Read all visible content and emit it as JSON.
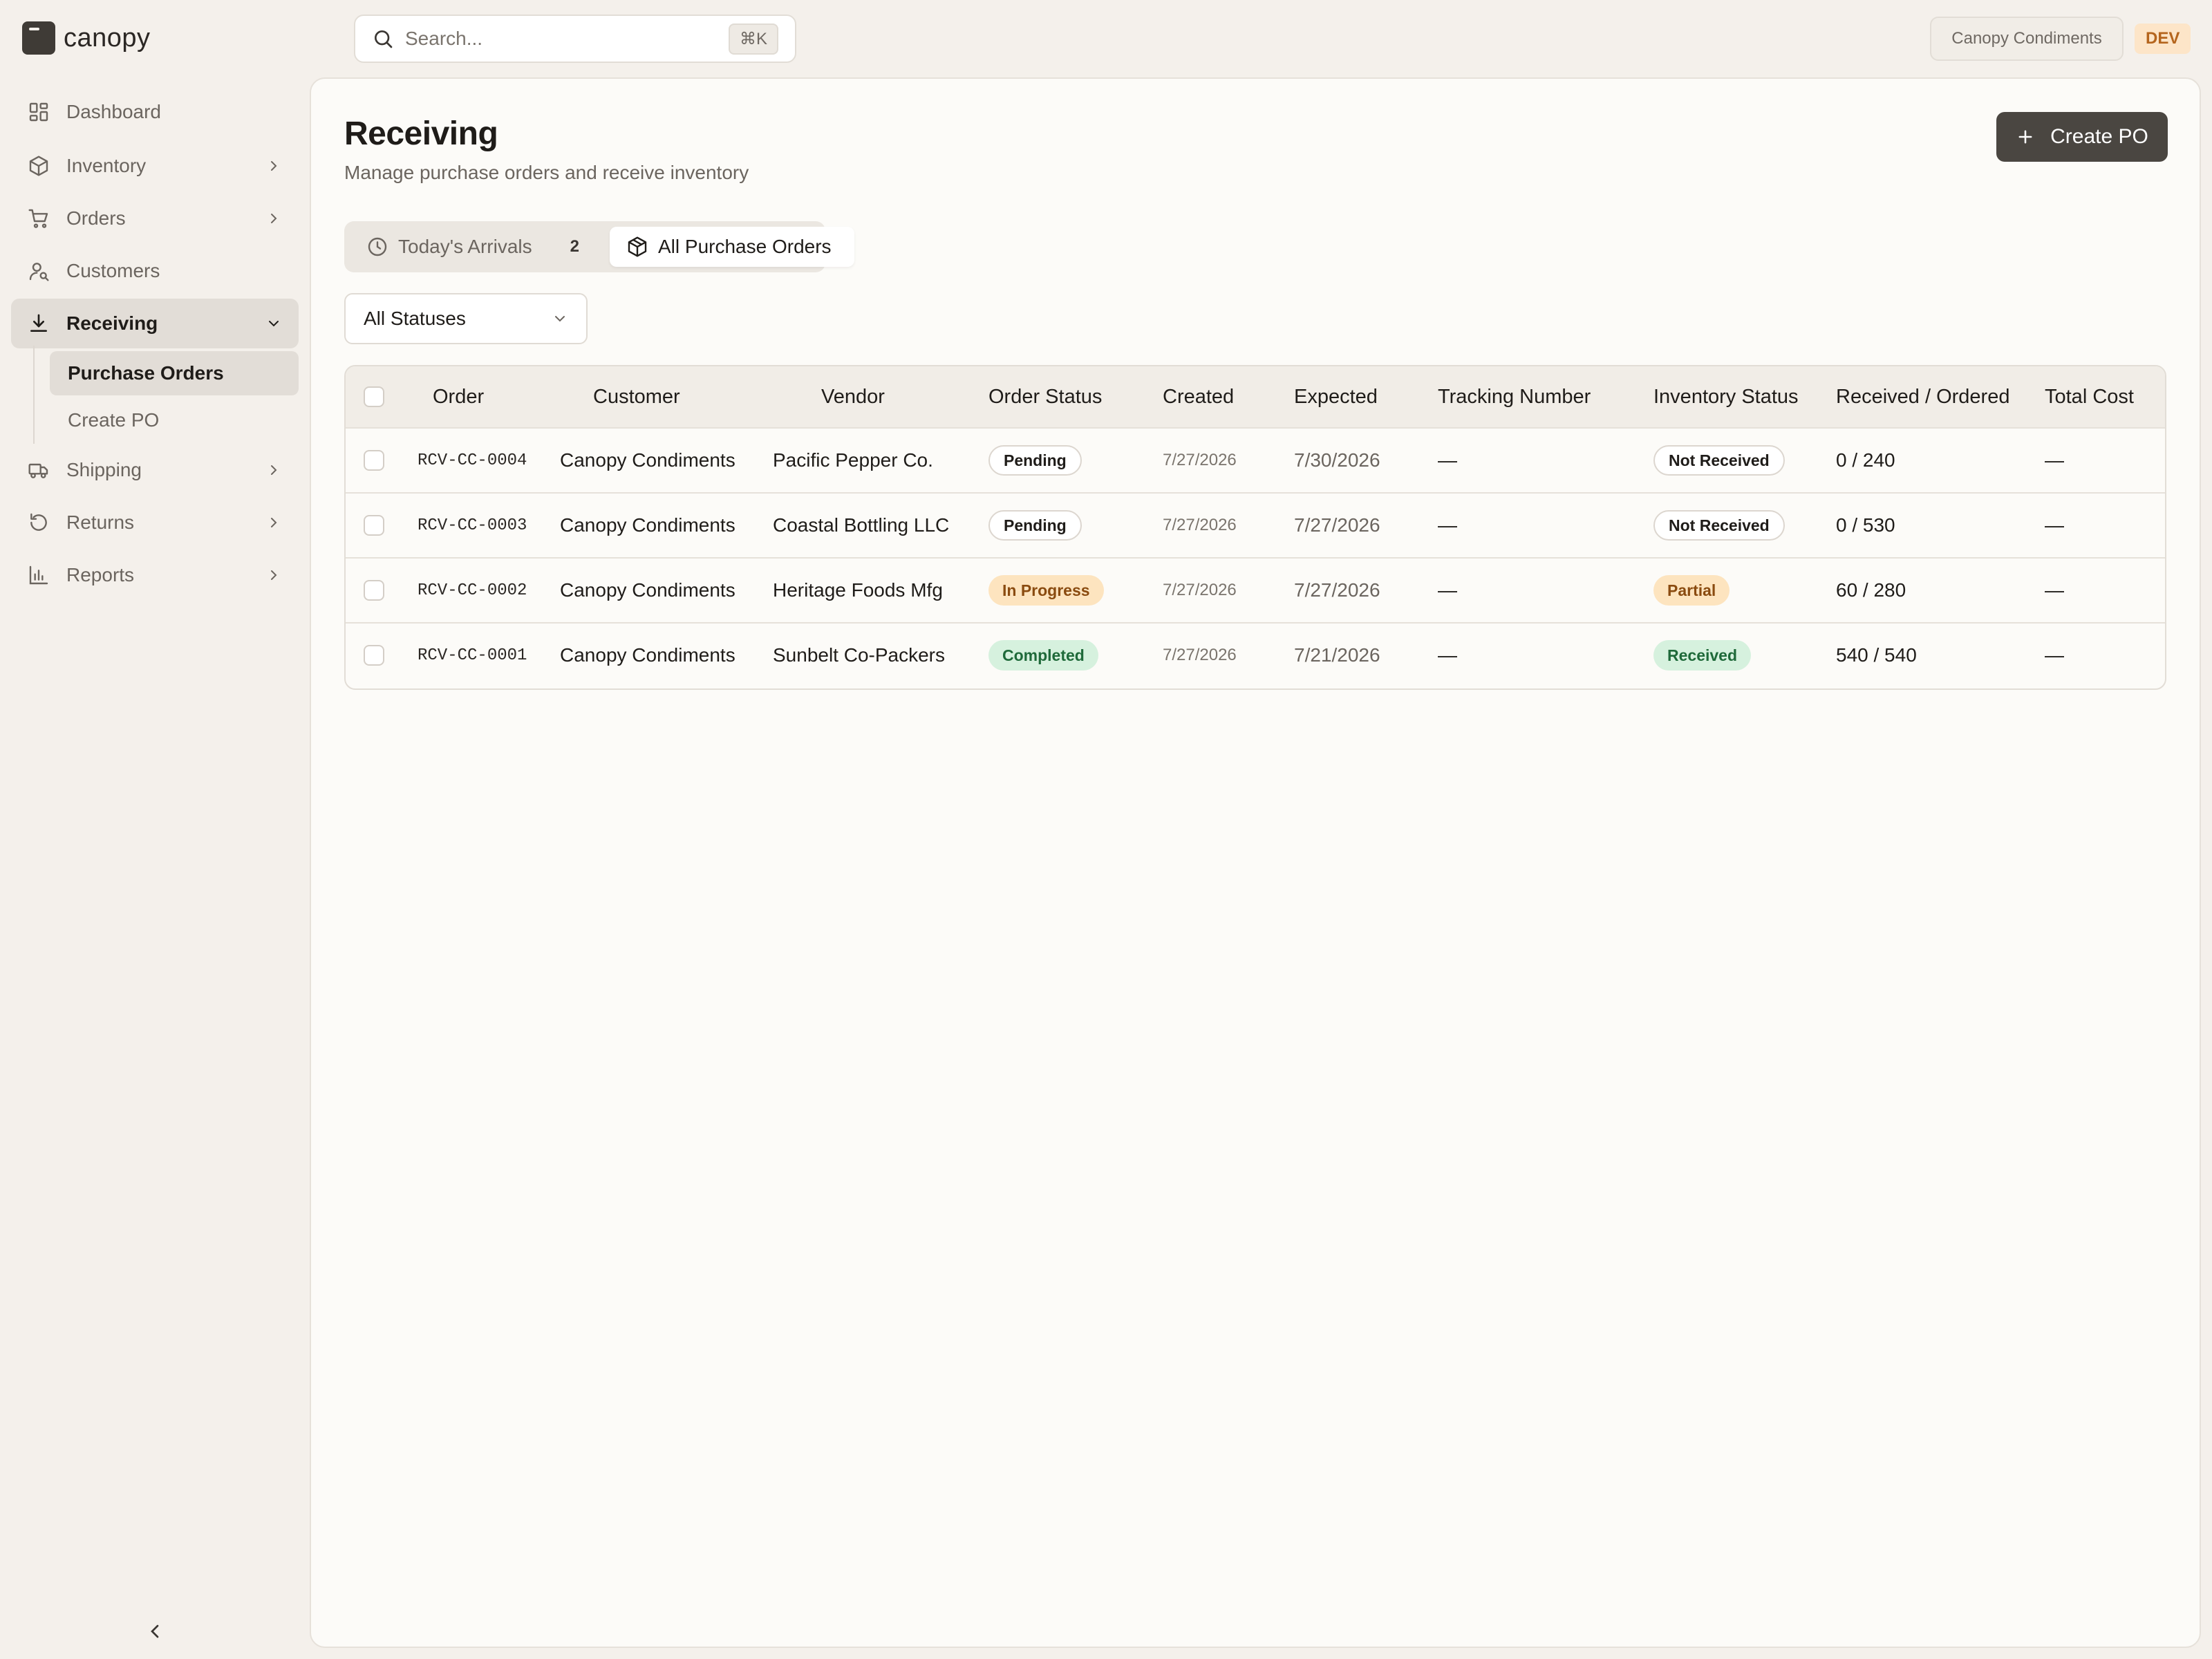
{
  "app": {
    "brand": "canopy"
  },
  "search": {
    "placeholder": "Search...",
    "shortcut": "⌘K"
  },
  "topbar": {
    "tenant": "Canopy Condiments",
    "env_badge": "DEV"
  },
  "sidebar": {
    "items": [
      {
        "label": "Dashboard",
        "icon": "dashboard-icon"
      },
      {
        "label": "Inventory",
        "icon": "box-icon"
      },
      {
        "label": "Orders",
        "icon": "cart-icon"
      },
      {
        "label": "Customers",
        "icon": "customers-icon"
      },
      {
        "label": "Receiving",
        "icon": "download-icon"
      },
      {
        "label": "Shipping",
        "icon": "truck-icon"
      },
      {
        "label": "Returns",
        "icon": "returns-icon"
      },
      {
        "label": "Reports",
        "icon": "bar-chart-icon"
      }
    ],
    "receiving_sub": [
      {
        "label": "Purchase Orders"
      },
      {
        "label": "Create PO"
      }
    ]
  },
  "page": {
    "title": "Receiving",
    "subtitle": "Manage purchase orders and receive inventory",
    "create_button": "Create PO"
  },
  "tabs": {
    "today": {
      "label": "Today's Arrivals",
      "count": "2"
    },
    "all": {
      "label": "All Purchase Orders"
    }
  },
  "filter": {
    "status": "All Statuses"
  },
  "table": {
    "headers": [
      "Order",
      "Customer",
      "Vendor",
      "Order Status",
      "Created",
      "Expected",
      "Tracking Number",
      "Inventory Status",
      "Received / Ordered",
      "Total Cost"
    ],
    "rows": [
      {
        "order": "RCV-CC-0004",
        "customer": "Canopy Condiments",
        "vendor": "Pacific Pepper Co.",
        "order_status": "Pending",
        "created": "7/27/2026",
        "expected": "7/30/2026",
        "tracking": "—",
        "inventory_status": "Not Received",
        "received_ordered": "0 / 240",
        "total_cost": "—"
      },
      {
        "order": "RCV-CC-0003",
        "customer": "Canopy Condiments",
        "vendor": "Coastal Bottling LLC",
        "order_status": "Pending",
        "created": "7/27/2026",
        "expected": "7/27/2026",
        "tracking": "—",
        "inventory_status": "Not Received",
        "received_ordered": "0 / 530",
        "total_cost": "—"
      },
      {
        "order": "RCV-CC-0002",
        "customer": "Canopy Condiments",
        "vendor": "Heritage Foods Mfg",
        "order_status": "In Progress",
        "created": "7/27/2026",
        "expected": "7/27/2026",
        "tracking": "—",
        "inventory_status": "Partial",
        "received_ordered": "60 / 280",
        "total_cost": "—"
      },
      {
        "order": "RCV-CC-0001",
        "customer": "Canopy Condiments",
        "vendor": "Sunbelt Co-Packers",
        "order_status": "Completed",
        "created": "7/27/2026",
        "expected": "7/21/2026",
        "tracking": "—",
        "inventory_status": "Received",
        "received_ordered": "540 / 540",
        "total_cost": "—"
      }
    ]
  },
  "colors": {
    "background": "#f4f0eb",
    "panel": "#fcfbf8",
    "primary_button": "#4a4641",
    "warn_badge": "#fde4bf",
    "ok_badge": "#d6f1de",
    "dev_badge": "#fde5c8"
  }
}
